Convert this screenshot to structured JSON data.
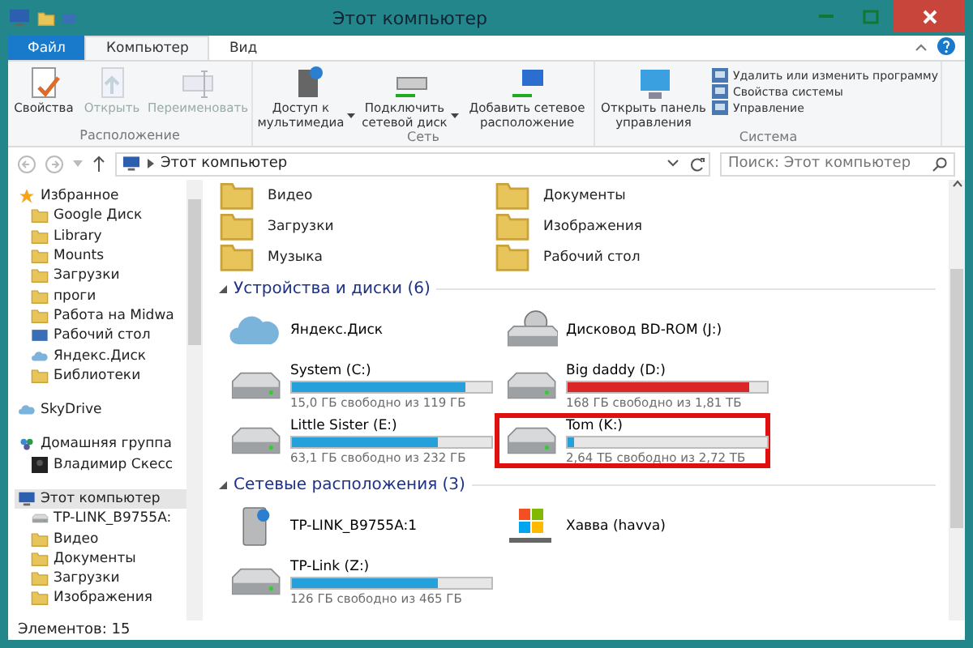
{
  "window": {
    "title": "Этот компьютер"
  },
  "tabs": [
    {
      "label": "Файл",
      "kind": "file",
      "selected": false
    },
    {
      "label": "Компьютер",
      "kind": "tab",
      "selected": true
    },
    {
      "label": "Вид",
      "kind": "tab",
      "selected": false
    }
  ],
  "ribbon": {
    "groups": [
      {
        "label": "Расположение",
        "buttons": [
          {
            "label": "Свойства",
            "kind": "props",
            "disabled": false
          },
          {
            "label": "Открыть",
            "kind": "open",
            "disabled": true
          },
          {
            "label": "Переименовать",
            "kind": "rename",
            "disabled": true
          }
        ]
      },
      {
        "label": "Сеть",
        "buttons": [
          {
            "label": "Доступ к мультимедиа",
            "kind": "media",
            "dropdown": true,
            "disabled": false
          },
          {
            "label": "Подключить сетевой диск",
            "kind": "netdrive",
            "dropdown": true,
            "disabled": false
          },
          {
            "label": "Добавить сетевое расположение",
            "kind": "netloc",
            "disabled": false
          }
        ]
      },
      {
        "label": "Система",
        "buttons": [
          {
            "label": "Открыть панель управления",
            "kind": "panel",
            "disabled": false
          }
        ],
        "small_buttons": [
          "Удалить или изменить программу",
          "Свойства системы",
          "Управление"
        ]
      }
    ]
  },
  "address": {
    "path": "Этот компьютер",
    "search_placeholder": "Поиск: Этот компьютер"
  },
  "nav": [
    {
      "label": "Избранное",
      "kind": "star",
      "selected": false,
      "children": [
        {
          "label": "Google Диск",
          "kind": "folder",
          "selected": false
        },
        {
          "label": "Library",
          "kind": "folder",
          "selected": false
        },
        {
          "label": "Mounts",
          "kind": "folder",
          "selected": false
        },
        {
          "label": "Загрузки",
          "kind": "folder",
          "selected": false
        },
        {
          "label": "проги",
          "kind": "folder",
          "selected": false
        },
        {
          "label": "Работа на Midwa",
          "kind": "folder",
          "selected": false
        },
        {
          "label": "Рабочий стол",
          "kind": "desktop",
          "selected": false
        },
        {
          "label": "Яндекс.Диск",
          "kind": "cloud",
          "selected": false
        },
        {
          "label": "Библиотеки",
          "kind": "folder",
          "selected": false
        }
      ]
    },
    {
      "label": "SkyDrive",
      "kind": "cloud",
      "selected": false
    },
    {
      "label": "Домашняя группа",
      "kind": "group",
      "selected": false,
      "children": [
        {
          "label": "Владимир Скесс",
          "kind": "user",
          "selected": false
        }
      ]
    },
    {
      "label": "Этот компьютер",
      "kind": "pc",
      "selected": true,
      "children": [
        {
          "label": "TP-LINK_B9755A:",
          "kind": "drive",
          "selected": false
        },
        {
          "label": "Видео",
          "kind": "folder",
          "selected": false
        },
        {
          "label": "Документы",
          "kind": "folder",
          "selected": false
        },
        {
          "label": "Загрузки",
          "kind": "folder",
          "selected": false
        },
        {
          "label": "Изображения",
          "kind": "folder",
          "selected": false
        }
      ]
    }
  ],
  "folders": [
    {
      "name": "Видео"
    },
    {
      "name": "Документы"
    },
    {
      "name": "Загрузки"
    },
    {
      "name": "Изображения"
    },
    {
      "name": "Музыка"
    },
    {
      "name": "Рабочий стол"
    }
  ],
  "sections": [
    {
      "title": "Устройства и диски (6)",
      "items": [
        {
          "name": "Яндекс.Диск",
          "kind": "cloud",
          "highlighted": false
        },
        {
          "name": "Дисковод BD-ROM (J:)",
          "kind": "optical",
          "highlighted": false
        },
        {
          "name": "System (C:)",
          "kind": "drive",
          "level": 0.87,
          "color": "#26a0da",
          "free": "15,0 ГБ свободно из 119 ГБ",
          "highlighted": false
        },
        {
          "name": "Big daddy (D:)",
          "kind": "drive",
          "level": 0.91,
          "color": "#da2626",
          "free": "168 ГБ свободно из 1,81 ТБ",
          "highlighted": false
        },
        {
          "name": "Little Sister (E:)",
          "kind": "drive",
          "level": 0.73,
          "color": "#26a0da",
          "free": "63,1 ГБ свободно из 232 ГБ",
          "highlighted": false
        },
        {
          "name": "Tom (K:)",
          "kind": "drive",
          "level": 0.03,
          "color": "#26a0da",
          "free": "2,64 ТБ свободно из 2,72 ТБ",
          "highlighted": true
        }
      ]
    },
    {
      "title": "Сетевые расположения (3)",
      "items": [
        {
          "name": "TP-LINK_B9755A:1",
          "kind": "netdevice",
          "highlighted": false
        },
        {
          "name": "Хавва (havva)",
          "kind": "media",
          "highlighted": false
        },
        {
          "name": "TP-Link (Z:)",
          "kind": "drive",
          "level": 0.73,
          "color": "#26a0da",
          "free": "126 ГБ свободно из 465 ГБ",
          "highlighted": false
        }
      ]
    }
  ],
  "status_bar": {
    "count": "Элементов: 15"
  }
}
